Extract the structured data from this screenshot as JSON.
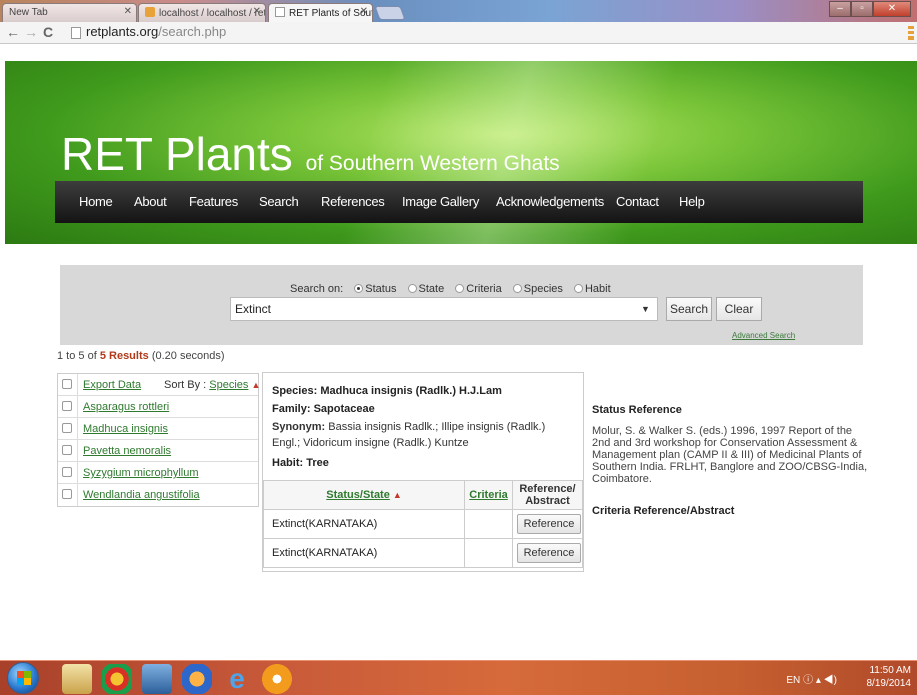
{
  "browser": {
    "tabs": [
      {
        "label": "New Tab"
      },
      {
        "label": "localhost / localhost / ret"
      },
      {
        "label": "RET Plants of Southern W"
      }
    ],
    "url_domain": "retplants.org",
    "url_path": "/search.php"
  },
  "site": {
    "title_main": "RET Plants",
    "title_sub": "of Southern Western Ghats",
    "nav": [
      "Home",
      "About",
      "Features",
      "Search",
      "References",
      "Image Gallery",
      "Acknowledgements",
      "Contact",
      "Help"
    ]
  },
  "search": {
    "search_on_label": "Search on:",
    "options": [
      "Status",
      "State",
      "Criteria",
      "Species",
      "Habit"
    ],
    "selected_option": "Status",
    "query": "Extinct",
    "search_button": "Search",
    "clear_button": "Clear",
    "advanced_link": "Advanced Search"
  },
  "results": {
    "range": "1 to 5 of",
    "count": "5 Results",
    "time": "(0.20 seconds)",
    "export_label": "Export Data",
    "sort_by_label": "Sort By :",
    "sort_field": "Species",
    "items": [
      "Asparagus rottleri",
      "Madhuca insignis",
      "Pavetta nemoralis",
      "Syzygium microphyllum",
      "Wendlandia angustifolia"
    ]
  },
  "detail": {
    "species_label": "Species:",
    "species": "Madhuca insignis (Radlk.) H.J.Lam",
    "family_label": "Family:",
    "family": "Sapotaceae",
    "synonym_label": "Synonym:",
    "synonym": "Bassia insignis Radlk.; Illipe insignis (Radlk.) Engl.; Vidoricum insigne (Radlk.) Kuntze",
    "habit_label": "Habit:",
    "habit": "Tree",
    "table": {
      "headers": [
        "Status/State",
        "Criteria",
        "Reference/ Abstract"
      ],
      "rows": [
        {
          "status": "Extinct(KARNATAKA)",
          "criteria": "",
          "ref": "Reference"
        },
        {
          "status": "Extinct(KARNATAKA)",
          "criteria": "",
          "ref": "Reference"
        }
      ]
    }
  },
  "reference": {
    "status_title": "Status Reference",
    "status_text": "Molur, S. & Walker S. (eds.) 1996, 1997 Report of the 2nd and 3rd workshop for Conservation Assessment & Management plan (CAMP II & III) of Medicinal Plants of Southern India. FRLHT, Banglore and ZOO/CBSG-India, Coimbatore.",
    "criteria_title": "Criteria Reference/Abstract"
  },
  "taskbar": {
    "language": "EN",
    "time": "11:50 AM",
    "date": "8/19/2014"
  },
  "colors": {
    "nav_bg": "#1e1e1e",
    "link_green": "#2f7a2f",
    "result_red": "#b03a1a",
    "banner_green": "#5cb82c",
    "taskbar": "#c85a3a"
  }
}
